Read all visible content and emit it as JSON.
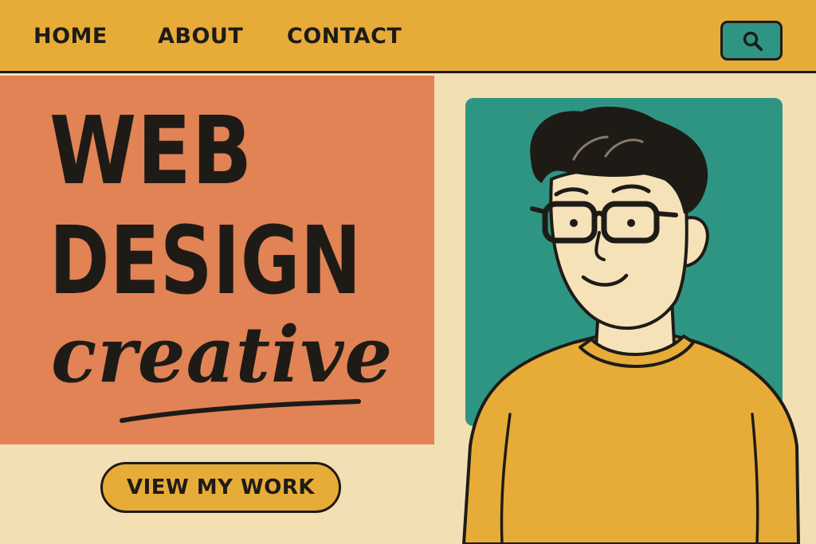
{
  "nav": {
    "home_label": "HOME",
    "about_label": "ABOUT",
    "contact_label": "CONTACT",
    "search_icon": "search-icon"
  },
  "hero": {
    "line1": "WEB",
    "line2": "DESIGN",
    "script": "creative",
    "cta_label": "VIEW MY WORK"
  },
  "colors": {
    "nav_bg": "#e7ac38",
    "hero_block": "#e18355",
    "portrait_bg": "#2f9583",
    "page_bg": "#f3dfb4",
    "ink": "#1e1b17",
    "sweater": "#e7ac38",
    "skin": "#f5e2b8"
  }
}
